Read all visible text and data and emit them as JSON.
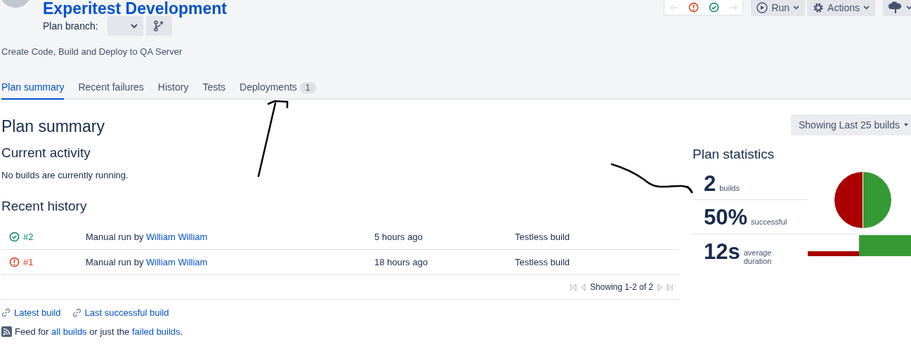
{
  "header": {
    "title": "Experitest Development",
    "branch_label": "Plan branch:",
    "description": "Create Code, Build and Deploy to QA Server",
    "buttons": [
      "Run",
      "Actions"
    ]
  },
  "tabs": [
    {
      "label": "Plan summary",
      "selected": true
    },
    {
      "label": "Recent failures",
      "selected": false
    },
    {
      "label": "History",
      "selected": false
    },
    {
      "label": "Tests",
      "selected": false
    },
    {
      "label": "Deployments",
      "selected": false,
      "badge": "1"
    }
  ],
  "summary": {
    "title": "Plan summary",
    "filter": "Showing Last 25 builds",
    "current_heading": "Current activity",
    "current_text": "No builds are currently running.",
    "history_heading": "Recent history",
    "builds": [
      {
        "kind": "success",
        "number": "#2",
        "trigger": "Manual run by",
        "user": "William William",
        "time": "5 hours ago",
        "tests": "Testless build"
      },
      {
        "kind": "failed",
        "number": "#1",
        "trigger": "Manual run by",
        "user": "William William",
        "time": "18 hours ago",
        "tests": "Testless build"
      }
    ],
    "pagination": "Showing 1-2 of 2",
    "links": [
      "Latest build",
      "Last successful build"
    ],
    "feed": {
      "prefix": "Feed for",
      "all_link": "all builds",
      "middle": "or just the",
      "failed_link": "failed builds",
      "suffix": "."
    }
  },
  "stats": {
    "title": "Plan statistics",
    "items": [
      {
        "value": "2",
        "label": "builds"
      },
      {
        "value": "50%",
        "label": "successful"
      },
      {
        "value": "12s",
        "label": "average duration"
      }
    ]
  }
}
